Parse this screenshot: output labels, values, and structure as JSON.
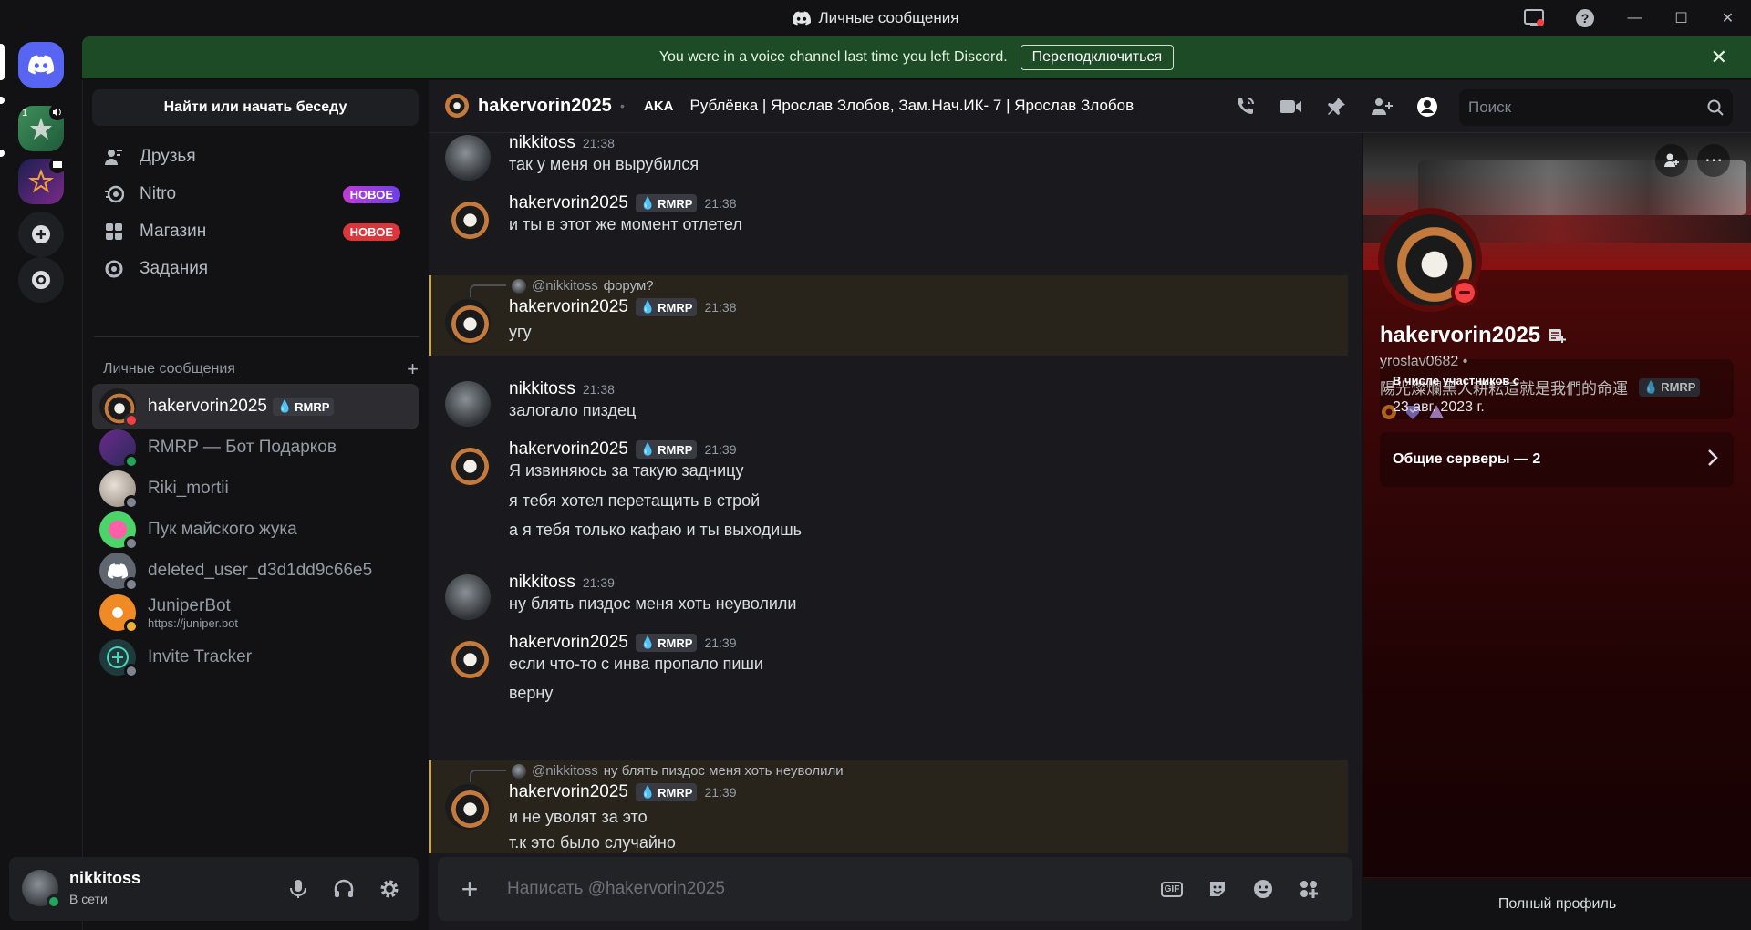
{
  "window": {
    "title": "Личные сообщения"
  },
  "banner": {
    "message": "You were in a voice channel last time you left Discord.",
    "reconnect_label": "Переподключиться"
  },
  "sidebar": {
    "find_label": "Найти или начать беседу",
    "nav": [
      {
        "label": "Друзья",
        "icon": "friends-icon"
      },
      {
        "label": "Nitro",
        "icon": "nitro-icon",
        "badge": "НОВОЕ"
      },
      {
        "label": "Магазин",
        "icon": "shop-icon",
        "badge": "НОВОЕ"
      },
      {
        "label": "Задания",
        "icon": "quests-icon"
      }
    ],
    "dm_header": "Личные сообщения",
    "dms": [
      {
        "name": "hakervorin2025",
        "tag": "RMRP",
        "status": "dnd"
      },
      {
        "name": "RMRP — Бот Подарков",
        "status": "online"
      },
      {
        "name": "Riki_mortii",
        "status": "offline"
      },
      {
        "name": "Пук майского жука",
        "status": "offline"
      },
      {
        "name": "deleted_user_d3d1dd9c66e5",
        "status": "offline"
      },
      {
        "name": "JuniperBot",
        "sub": "https://juniper.bot",
        "status": "idle"
      },
      {
        "name": "Invite Tracker",
        "status": "offline"
      }
    ]
  },
  "user_panel": {
    "name": "nikkitoss",
    "status": "В сети"
  },
  "guilds": {
    "badge_count": "1"
  },
  "chat_header": {
    "user": "hakervorin2025",
    "aka_label": "AKA",
    "aka_names": "Рублёвка | Ярослав Злобов, Зам.Нач.ИК- 7 | Ярослав Злобов",
    "search_placeholder": "Поиск"
  },
  "messages": [
    {
      "author": "nikkitoss",
      "time": "21:38",
      "lines": [
        "так у меня он вырубился"
      ]
    },
    {
      "author": "hakervorin2025",
      "tag": "RMRP",
      "time": "21:38",
      "lines": [
        "и ты в этот же момент отлетел"
      ]
    },
    {
      "author": "hakervorin2025",
      "tag": "RMRP",
      "time": "21:38",
      "reply_mention": "@nikkitoss",
      "reply_text": "форум?",
      "lines": [
        "угу"
      ]
    },
    {
      "author": "nikkitoss",
      "time": "21:38",
      "lines": [
        "залогало пиздец"
      ]
    },
    {
      "author": "hakervorin2025",
      "tag": "RMRP",
      "time": "21:39",
      "lines": [
        "Я извиняюсь за такую задницу",
        "я тебя хотел перетащить в строй",
        "а я тебя только кафаю и ты выходишь"
      ]
    },
    {
      "author": "nikkitoss",
      "time": "21:39",
      "lines": [
        "ну блять пиздос меня хоть неуволили"
      ]
    },
    {
      "author": "hakervorin2025",
      "tag": "RMRP",
      "time": "21:39",
      "lines": [
        "если что-то с инва пропало пиши",
        "верну"
      ]
    },
    {
      "author": "hakervorin2025",
      "tag": "RMRP",
      "time": "21:39",
      "reply_mention": "@nikkitoss",
      "reply_text": "ну блять пиздос меня хоть неуволили",
      "lines": [
        "и не уволят за это",
        "т.к это было случайно"
      ]
    }
  ],
  "composer": {
    "placeholder": "Написать @hakervorin2025",
    "gif_label": "GIF"
  },
  "profile": {
    "display_name": "hakervorin2025",
    "username": "yroslav0682",
    "bio": "陽光燦爛黑人耕耘這就是我們的命運",
    "tag": "RMRP",
    "member_since_label": "В числе участников с",
    "member_since": "23 авг. 2023 г.",
    "mutual_servers": "Общие серверы — 2",
    "full_profile": "Полный профиль"
  },
  "colors": {
    "accent": "#5865f2",
    "banner_green": "#1c4b26",
    "dnd": "#f23f43",
    "online": "#23a55a",
    "idle": "#f0b232"
  }
}
